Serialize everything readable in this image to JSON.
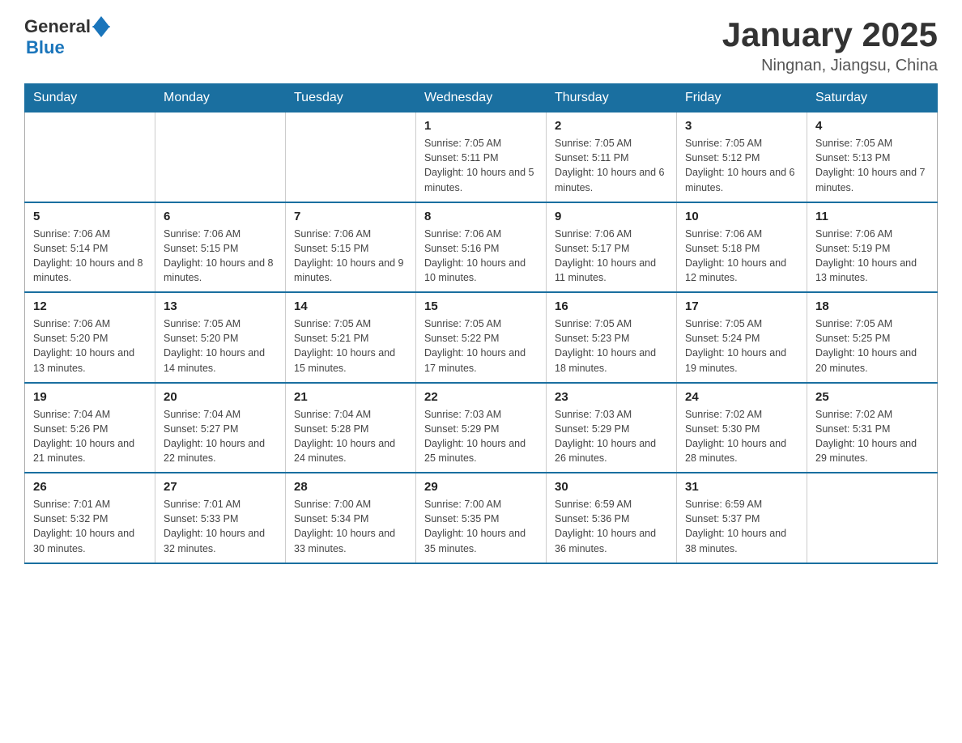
{
  "header": {
    "logo_general": "General",
    "logo_blue": "Blue",
    "title": "January 2025",
    "subtitle": "Ningnan, Jiangsu, China"
  },
  "days_of_week": [
    "Sunday",
    "Monday",
    "Tuesday",
    "Wednesday",
    "Thursday",
    "Friday",
    "Saturday"
  ],
  "weeks": [
    [
      {
        "day": "",
        "info": ""
      },
      {
        "day": "",
        "info": ""
      },
      {
        "day": "",
        "info": ""
      },
      {
        "day": "1",
        "info": "Sunrise: 7:05 AM\nSunset: 5:11 PM\nDaylight: 10 hours and 5 minutes."
      },
      {
        "day": "2",
        "info": "Sunrise: 7:05 AM\nSunset: 5:11 PM\nDaylight: 10 hours and 6 minutes."
      },
      {
        "day": "3",
        "info": "Sunrise: 7:05 AM\nSunset: 5:12 PM\nDaylight: 10 hours and 6 minutes."
      },
      {
        "day": "4",
        "info": "Sunrise: 7:05 AM\nSunset: 5:13 PM\nDaylight: 10 hours and 7 minutes."
      }
    ],
    [
      {
        "day": "5",
        "info": "Sunrise: 7:06 AM\nSunset: 5:14 PM\nDaylight: 10 hours and 8 minutes."
      },
      {
        "day": "6",
        "info": "Sunrise: 7:06 AM\nSunset: 5:15 PM\nDaylight: 10 hours and 8 minutes."
      },
      {
        "day": "7",
        "info": "Sunrise: 7:06 AM\nSunset: 5:15 PM\nDaylight: 10 hours and 9 minutes."
      },
      {
        "day": "8",
        "info": "Sunrise: 7:06 AM\nSunset: 5:16 PM\nDaylight: 10 hours and 10 minutes."
      },
      {
        "day": "9",
        "info": "Sunrise: 7:06 AM\nSunset: 5:17 PM\nDaylight: 10 hours and 11 minutes."
      },
      {
        "day": "10",
        "info": "Sunrise: 7:06 AM\nSunset: 5:18 PM\nDaylight: 10 hours and 12 minutes."
      },
      {
        "day": "11",
        "info": "Sunrise: 7:06 AM\nSunset: 5:19 PM\nDaylight: 10 hours and 13 minutes."
      }
    ],
    [
      {
        "day": "12",
        "info": "Sunrise: 7:06 AM\nSunset: 5:20 PM\nDaylight: 10 hours and 13 minutes."
      },
      {
        "day": "13",
        "info": "Sunrise: 7:05 AM\nSunset: 5:20 PM\nDaylight: 10 hours and 14 minutes."
      },
      {
        "day": "14",
        "info": "Sunrise: 7:05 AM\nSunset: 5:21 PM\nDaylight: 10 hours and 15 minutes."
      },
      {
        "day": "15",
        "info": "Sunrise: 7:05 AM\nSunset: 5:22 PM\nDaylight: 10 hours and 17 minutes."
      },
      {
        "day": "16",
        "info": "Sunrise: 7:05 AM\nSunset: 5:23 PM\nDaylight: 10 hours and 18 minutes."
      },
      {
        "day": "17",
        "info": "Sunrise: 7:05 AM\nSunset: 5:24 PM\nDaylight: 10 hours and 19 minutes."
      },
      {
        "day": "18",
        "info": "Sunrise: 7:05 AM\nSunset: 5:25 PM\nDaylight: 10 hours and 20 minutes."
      }
    ],
    [
      {
        "day": "19",
        "info": "Sunrise: 7:04 AM\nSunset: 5:26 PM\nDaylight: 10 hours and 21 minutes."
      },
      {
        "day": "20",
        "info": "Sunrise: 7:04 AM\nSunset: 5:27 PM\nDaylight: 10 hours and 22 minutes."
      },
      {
        "day": "21",
        "info": "Sunrise: 7:04 AM\nSunset: 5:28 PM\nDaylight: 10 hours and 24 minutes."
      },
      {
        "day": "22",
        "info": "Sunrise: 7:03 AM\nSunset: 5:29 PM\nDaylight: 10 hours and 25 minutes."
      },
      {
        "day": "23",
        "info": "Sunrise: 7:03 AM\nSunset: 5:29 PM\nDaylight: 10 hours and 26 minutes."
      },
      {
        "day": "24",
        "info": "Sunrise: 7:02 AM\nSunset: 5:30 PM\nDaylight: 10 hours and 28 minutes."
      },
      {
        "day": "25",
        "info": "Sunrise: 7:02 AM\nSunset: 5:31 PM\nDaylight: 10 hours and 29 minutes."
      }
    ],
    [
      {
        "day": "26",
        "info": "Sunrise: 7:01 AM\nSunset: 5:32 PM\nDaylight: 10 hours and 30 minutes."
      },
      {
        "day": "27",
        "info": "Sunrise: 7:01 AM\nSunset: 5:33 PM\nDaylight: 10 hours and 32 minutes."
      },
      {
        "day": "28",
        "info": "Sunrise: 7:00 AM\nSunset: 5:34 PM\nDaylight: 10 hours and 33 minutes."
      },
      {
        "day": "29",
        "info": "Sunrise: 7:00 AM\nSunset: 5:35 PM\nDaylight: 10 hours and 35 minutes."
      },
      {
        "day": "30",
        "info": "Sunrise: 6:59 AM\nSunset: 5:36 PM\nDaylight: 10 hours and 36 minutes."
      },
      {
        "day": "31",
        "info": "Sunrise: 6:59 AM\nSunset: 5:37 PM\nDaylight: 10 hours and 38 minutes."
      },
      {
        "day": "",
        "info": ""
      }
    ]
  ]
}
